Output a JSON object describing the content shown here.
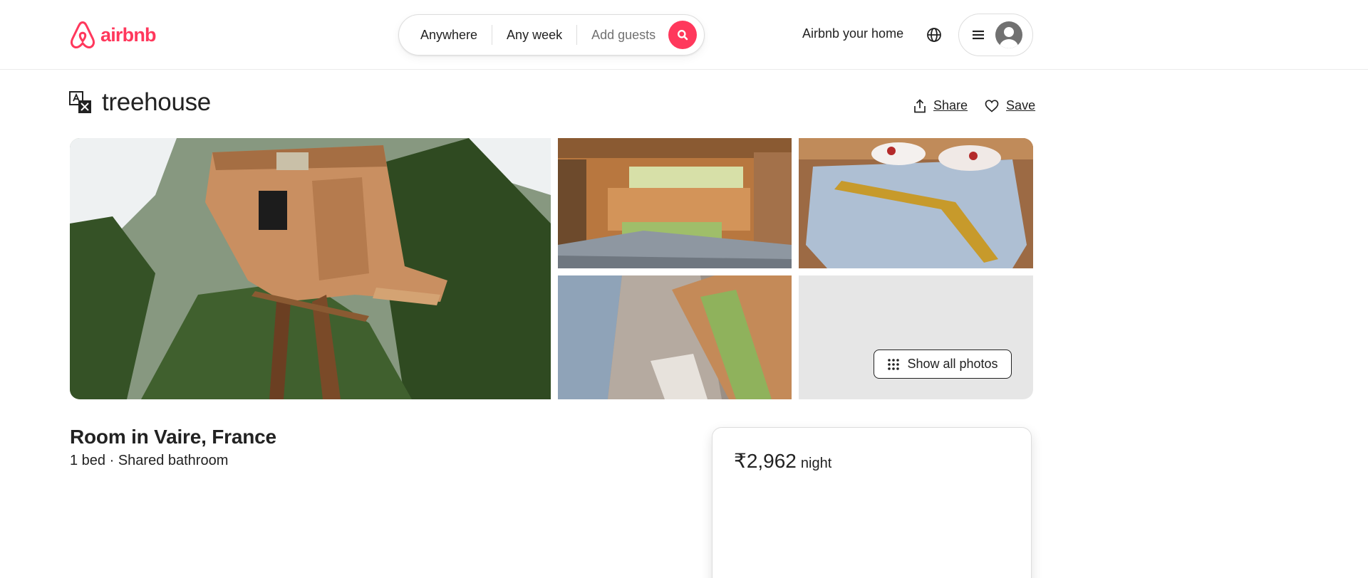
{
  "header": {
    "logo_text": "airbnb",
    "search": {
      "location": "Anywhere",
      "dates": "Any week",
      "guests_placeholder": "Add guests"
    },
    "host_link": "Airbnb your home"
  },
  "listing": {
    "title": "treehouse",
    "share_label": "Share",
    "save_label": "Save",
    "show_all_photos_label": "Show all photos",
    "room_title": "Room in Vaire, France",
    "room_subtitle": "1 bed · Shared bathroom",
    "price": "₹2,962",
    "price_unit": "night"
  },
  "colors": {
    "brand": "#ff385c",
    "text": "#222222",
    "border": "#dddddd"
  },
  "icons": [
    "airbnb-logo-icon",
    "search-icon",
    "globe-icon",
    "menu-icon",
    "avatar-icon",
    "translate-icon",
    "share-icon",
    "heart-icon",
    "grid-dots-icon"
  ]
}
